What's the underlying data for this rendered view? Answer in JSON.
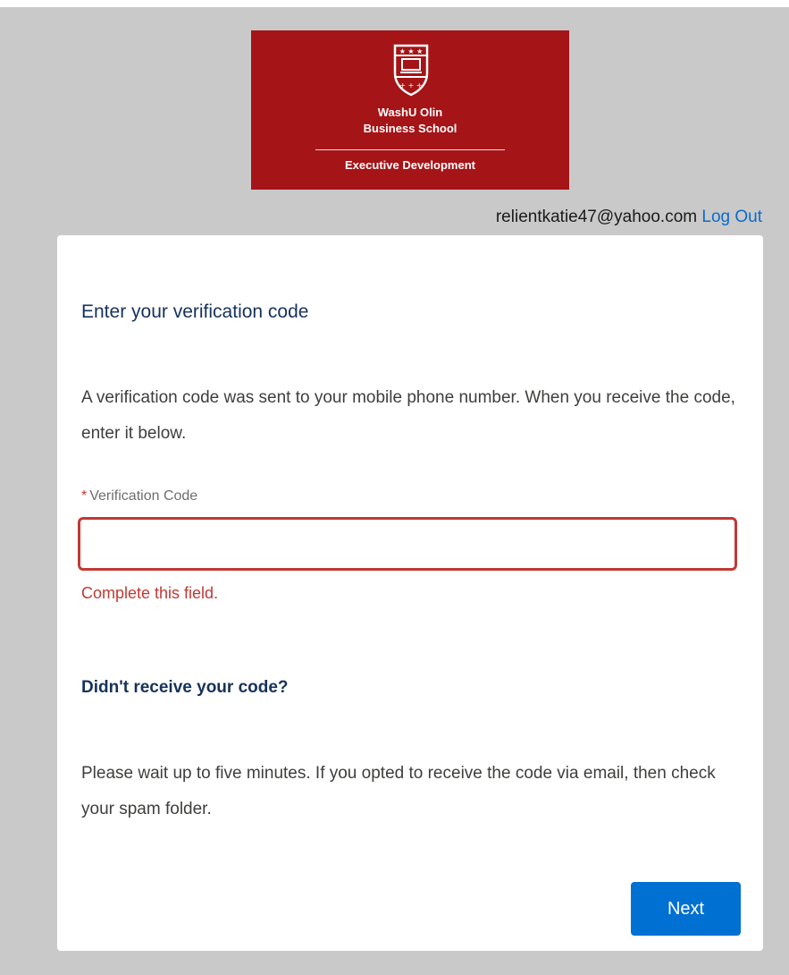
{
  "logo": {
    "line1": "WashU Olin",
    "line2": "Business School",
    "line3": "Executive Development",
    "background": "#a51417",
    "icon": "shield-crest-icon"
  },
  "header": {
    "email": "relientkatie47@yahoo.com",
    "logout_label": "Log Out"
  },
  "card": {
    "title": "Enter your verification code",
    "intro": "A verification code was sent to your mobile phone number. When you receive the code, enter it below.",
    "field": {
      "required_marker": "*",
      "label": "Verification Code",
      "value": "",
      "error": "Complete this field."
    },
    "help_title": "Didn't receive your code?",
    "help_text": "Please wait up to five minutes. If you opted to receive the code via email, then check your spam folder.",
    "next_label": "Next"
  },
  "colors": {
    "page_background": "#c9c9c9",
    "link": "#0b6bcb",
    "error": "#c23934",
    "button": "#0070d2",
    "title": "#16325c"
  }
}
